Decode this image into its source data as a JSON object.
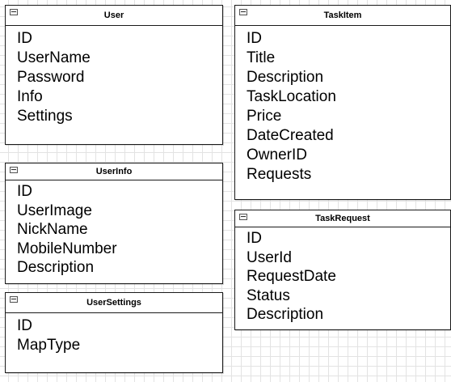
{
  "entities": {
    "user": {
      "title": "User",
      "fields": [
        "ID",
        "UserName",
        "Password",
        "Info",
        "Settings"
      ]
    },
    "task_item": {
      "title": "TaskItem",
      "fields": [
        "ID",
        "Title",
        "Description",
        "TaskLocation",
        "Price",
        "DateCreated",
        "OwnerID",
        "Requests"
      ]
    },
    "user_info": {
      "title": "UserInfo",
      "fields": [
        "ID",
        "UserImage",
        "NickName",
        "MobileNumber",
        "Description"
      ]
    },
    "task_request": {
      "title": "TaskRequest",
      "fields": [
        "ID",
        "UserId",
        "RequestDate",
        "Status",
        "Description"
      ]
    },
    "user_settings": {
      "title": "UserSettings",
      "fields": [
        "ID",
        "MapType"
      ]
    }
  }
}
